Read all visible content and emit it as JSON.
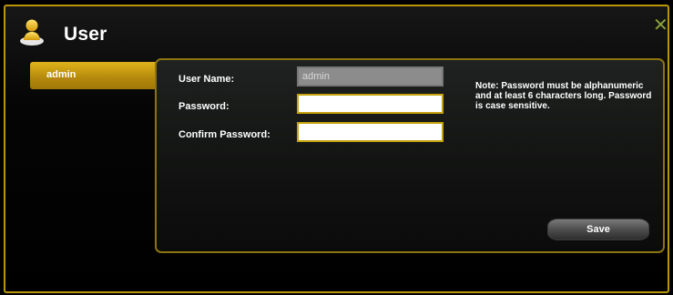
{
  "window": {
    "title": "User",
    "icon": "user-icon",
    "close_icon": "close-icon"
  },
  "sidebar": {
    "items": [
      {
        "label": "admin",
        "selected": true
      }
    ]
  },
  "form": {
    "username_label": "User Name:",
    "username_value": "admin",
    "password_label": "Password:",
    "password_value": "",
    "confirm_label": "Confirm Password:",
    "confirm_value": "",
    "note": "Note: Password must be alphanumeric and at least 6 characters long. Password is case sensitive.",
    "save_label": "Save"
  },
  "colors": {
    "accent": "#c4a20e",
    "selected_item": "#c89e14",
    "close": "#8aa23a"
  }
}
